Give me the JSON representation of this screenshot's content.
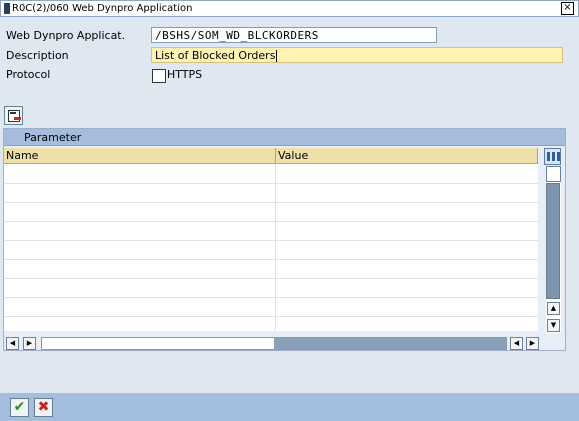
{
  "window": {
    "title": "R0C(2)/060 Web Dynpro Application",
    "close_glyph": "×"
  },
  "form": {
    "app_label": "Web Dynpro Applicat.",
    "app_value": "/BSHS/SOM_WD_BLCKORDERS",
    "description_label": "Description",
    "description_value": "List of Blocked Orders",
    "protocol_label": "Protocol",
    "https_label": "HTTPS",
    "https_checked": false
  },
  "parameters": {
    "panel_title": "Parameter",
    "columns": [
      "Name",
      "Value"
    ],
    "rows": [
      {
        "name": "",
        "value": ""
      },
      {
        "name": "",
        "value": ""
      },
      {
        "name": "",
        "value": ""
      },
      {
        "name": "",
        "value": ""
      },
      {
        "name": "",
        "value": ""
      },
      {
        "name": "",
        "value": ""
      },
      {
        "name": "",
        "value": ""
      },
      {
        "name": "",
        "value": ""
      },
      {
        "name": "",
        "value": ""
      }
    ]
  },
  "icons": {
    "toolbar": "edit-table-icon",
    "column_settings": "column-settings-icon",
    "ok": "checkmark-icon",
    "cancel": "cancel-x-icon"
  },
  "glyphs": {
    "up": "▲",
    "down": "▼",
    "left": "◀",
    "right": "▶",
    "ok": "✔",
    "cancel": "✖"
  }
}
